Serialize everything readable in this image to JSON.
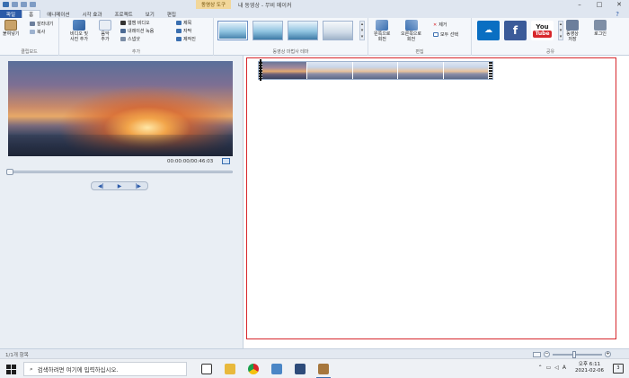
{
  "titlebar": {
    "tool_tab": "동영상 도구",
    "title": "내 동영상 - 무비 메이커",
    "minimize": "–",
    "maximize": "□",
    "close": "✕"
  },
  "tabs": {
    "file": "파일",
    "home": "홈",
    "animation": "애니메이션",
    "visual_effects": "시각 효과",
    "project": "프로젝트",
    "view": "보기",
    "edit": "편집",
    "help": "?"
  },
  "ribbon": {
    "clipboard": {
      "paste": "붙여넣기",
      "cut": "잘라내기",
      "copy": "복사",
      "label": "클립보드"
    },
    "add": {
      "add_media": "비디오 및\n사진 추가",
      "add_music": "음악\n추가",
      "webcam": "웹캠 비디오",
      "narration": "내레이션 녹음",
      "snapshot": "스냅샷",
      "title": "제목",
      "caption": "자막",
      "credits": "제작진",
      "label": "추가"
    },
    "themes": {
      "label": "동영상 마법사 테마"
    },
    "editing": {
      "rotate_left": "왼쪽으로\n회전",
      "rotate_right": "오른쪽으로\n회전",
      "remove": "제거",
      "select_all": "모두 선택",
      "label": "편집"
    },
    "share": {
      "save_movie": "동영상\n저장",
      "signin": "로그인",
      "label": "공유",
      "facebook": "f",
      "youtube_you": "You",
      "youtube_tube": "Tube"
    }
  },
  "player": {
    "timecode": "00:00:00/00:46:03",
    "prev": "◀|",
    "play": "▶",
    "next": "|▶"
  },
  "status": {
    "items": "1/1개 항목"
  },
  "taskbar": {
    "search_placeholder": "검색하려면 여기에 입력하십시오.",
    "time": "오후 6:11",
    "date": "2021-02-06",
    "ime": "A",
    "notifications": "3"
  },
  "colors": {
    "accent": "#2b5aa8",
    "selection": "#d7262b"
  }
}
